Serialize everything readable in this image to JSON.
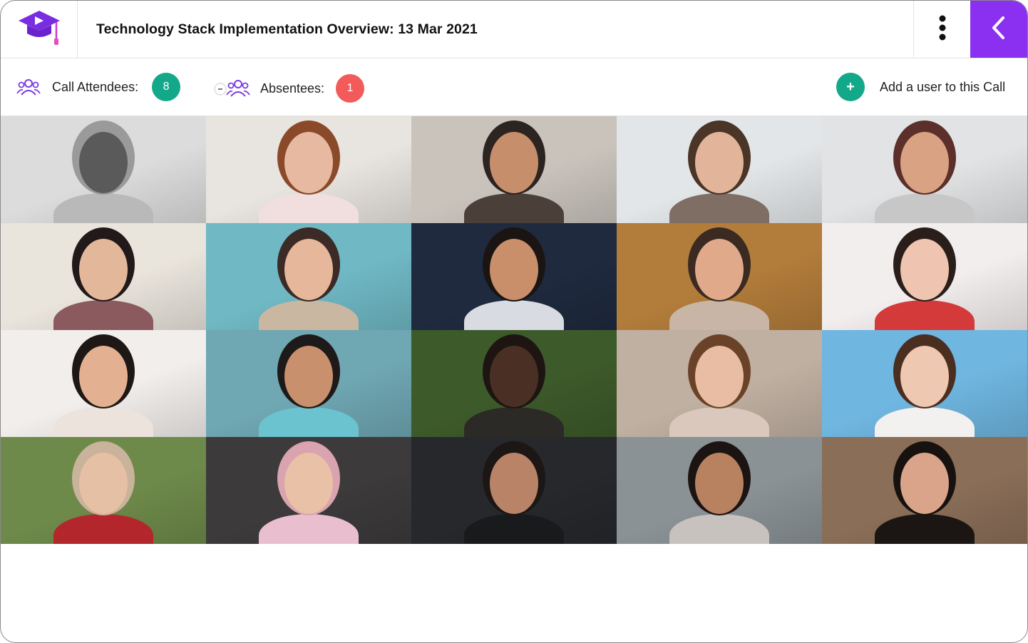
{
  "header": {
    "logo_icon": "graduation-cap-play-icon",
    "title": "Technology Stack Implementation Overview: 13 Mar 2021",
    "more_icon": "vertical-ellipsis-icon",
    "back_icon": "chevron-left-icon",
    "accent_color": "#8b2ff0"
  },
  "attendance": {
    "attendees_label": "Call Attendees:",
    "attendees_count": "8",
    "absentees_label": "Absentees:",
    "absentees_count": "1",
    "add_symbol": "+",
    "add_label": "Add a user to this Call",
    "attendee_color": "#13a88a",
    "absentee_color": "#f35a5a"
  },
  "participants": [
    {
      "bg": "#dcdcdc",
      "skin": "#5a5a5a",
      "hair": "#9a9a9a",
      "shirt": "#b9b9b9"
    },
    {
      "bg": "#e8e4df",
      "skin": "#e7b9a1",
      "hair": "#8a4a2a",
      "shirt": "#f1dede"
    },
    {
      "bg": "#c9c3bc",
      "skin": "#c78e6c",
      "hair": "#2c2420",
      "shirt": "#4b3f3a"
    },
    {
      "bg": "#e3e6e8",
      "skin": "#e2b59a",
      "hair": "#4a3526",
      "shirt": "#7f6e63"
    },
    {
      "bg": "#e1e3e4",
      "skin": "#d9a283",
      "hair": "#5c2f2a",
      "shirt": "#c7c7c7"
    },
    {
      "bg": "#e9e4dc",
      "skin": "#e3b89a",
      "hair": "#22191a",
      "shirt": "#8a5a5e"
    },
    {
      "bg": "#6fb8c4",
      "skin": "#e6b79a",
      "hair": "#3b2a25",
      "shirt": "#c9b7a2"
    },
    {
      "bg": "#1f2a3f",
      "skin": "#c98f6a",
      "hair": "#1a1412",
      "shirt": "#d8dce2"
    },
    {
      "bg": "#b27c3a",
      "skin": "#e0a98a",
      "hair": "#3a2a22",
      "shirt": "#c9b5a6"
    },
    {
      "bg": "#f3eeee",
      "skin": "#efc4b0",
      "hair": "#2a1e1b",
      "shirt": "#d43a3a"
    },
    {
      "bg": "#f1eeec",
      "skin": "#e3b091",
      "hair": "#1d1716",
      "shirt": "#ece3dc"
    },
    {
      "bg": "#6fa7b3",
      "skin": "#c8906d",
      "hair": "#1e1a1a",
      "shirt": "#6bc3cf"
    },
    {
      "bg": "#3d5a2a",
      "skin": "#4a3024",
      "hair": "#1e1512",
      "shirt": "#2b2a26"
    },
    {
      "bg": "#c0b0a2",
      "skin": "#e9bda3",
      "hair": "#6a4228",
      "shirt": "#d9c8bb"
    },
    {
      "bg": "#6fb6e0",
      "skin": "#efc8b2",
      "hair": "#4a2e20",
      "shirt": "#f3f1ef"
    },
    {
      "bg": "#6e8a4a",
      "skin": "#e6c0a4",
      "hair": "#c9b39a",
      "shirt": "#b3272c"
    },
    {
      "bg": "#3c3a3a",
      "skin": "#e8c1a6",
      "hair": "#d9a3b0",
      "shirt": "#e9bfd0"
    },
    {
      "bg": "#26282c",
      "skin": "#b98367",
      "hair": "#1c1614",
      "shirt": "#191a1c"
    },
    {
      "bg": "#8a9296",
      "skin": "#b88260",
      "hair": "#1b1412",
      "shirt": "#c8c2bf"
    },
    {
      "bg": "#8a6e58",
      "skin": "#d9a48a",
      "hair": "#17120f",
      "shirt": "#1b1614"
    }
  ]
}
